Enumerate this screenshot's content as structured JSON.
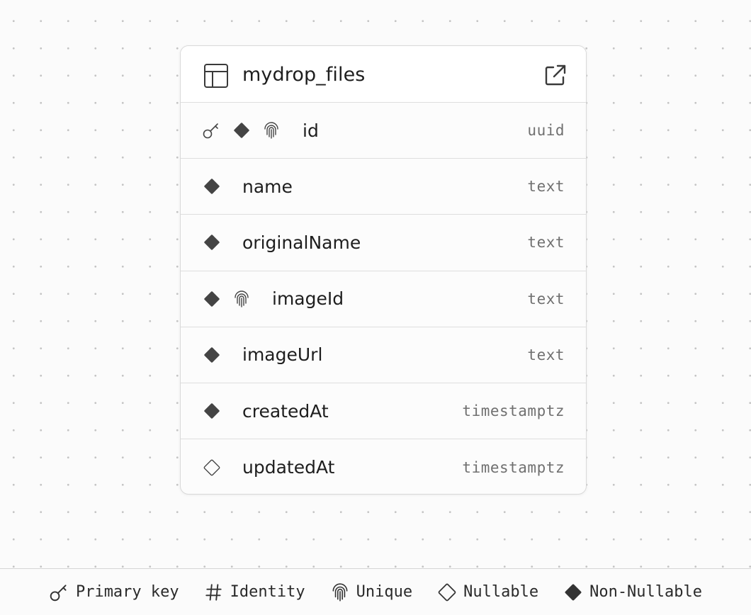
{
  "table": {
    "name": "mydrop_files",
    "columns": [
      {
        "name": "id",
        "type": "uuid",
        "icons": [
          "key-icon",
          "non-nullable-icon",
          "unique-icon"
        ]
      },
      {
        "name": "name",
        "type": "text",
        "icons": [
          "non-nullable-icon"
        ]
      },
      {
        "name": "originalName",
        "type": "text",
        "icons": [
          "non-nullable-icon"
        ]
      },
      {
        "name": "imageId",
        "type": "text",
        "icons": [
          "non-nullable-icon",
          "unique-icon"
        ]
      },
      {
        "name": "imageUrl",
        "type": "text",
        "icons": [
          "non-nullable-icon"
        ]
      },
      {
        "name": "createdAt",
        "type": "timestamptz",
        "icons": [
          "non-nullable-icon"
        ]
      },
      {
        "name": "updatedAt",
        "type": "timestamptz",
        "icons": [
          "nullable-icon"
        ]
      }
    ]
  },
  "legend": {
    "primary_key": "Primary key",
    "identity": "Identity",
    "unique": "Unique",
    "nullable": "Nullable",
    "non_nullable": "Non-Nullable"
  },
  "colors": {
    "icon_fill": "#444444",
    "border": "#dedede",
    "type_text": "#707070"
  }
}
